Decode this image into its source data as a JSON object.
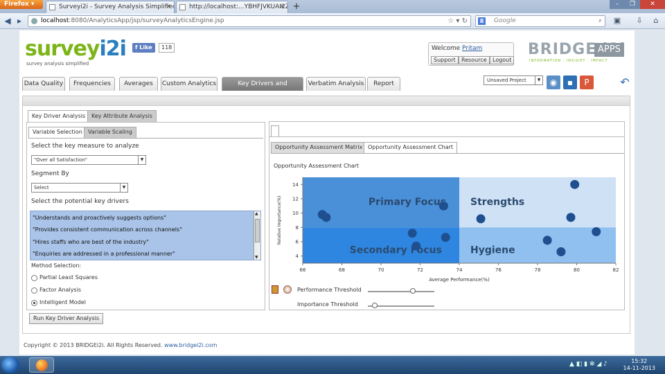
{
  "browser": {
    "menu_button": "Firefox",
    "tabs": [
      {
        "title": "Surveyi2i - Survey Analysis Simplified"
      },
      {
        "title": "http://localhost:...YBHFJVKUAI2Z6D6K"
      }
    ],
    "url_host": "localhost",
    "url_rest": ":8080/AnalyticsApp/jsp/surveyAnalyticsEngine.jsp",
    "search_engine_letter": "8",
    "search_placeholder": "Google"
  },
  "header": {
    "logo_a": "survey",
    "logo_b": "i2i",
    "tagline": "survey analysis simplified",
    "like_label": "Like",
    "like_count": "118",
    "welcome_label": "Welcome",
    "user_name": "Pritam",
    "support": "Support",
    "resource": "Resource",
    "logout": "Logout",
    "brand": "BRIDGE i2i",
    "brand_sub": "INFORMATION · INSIGHT · IMPACT",
    "apps": "APPS"
  },
  "main_tabs": [
    {
      "label": "Data Quality"
    },
    {
      "label": "Frequencies"
    },
    {
      "label": "Averages"
    },
    {
      "label": "Custom Analytics"
    },
    {
      "label": "Key Drivers and Attributes"
    },
    {
      "label": "Verbatim Analysis"
    },
    {
      "label": "Report"
    }
  ],
  "project_select": "Unsaved Project",
  "left": {
    "tabs": [
      "Key Driver Analysis",
      "Key Attribute Analysis"
    ],
    "subtabs": [
      "Variable Selection",
      "Variable Scaling"
    ],
    "measure_label": "Select the key measure to analyze",
    "measure_value": "\"Over all Satisfaction\"",
    "segment_label": "Segment By",
    "segment_value": "Select",
    "drivers_label": "Select the potential key drivers",
    "drivers": [
      "\"Understands and proactively suggests options\"",
      "\"Provides consistent communication across channels\"",
      "\"Hires staffs who are best of the industry\"",
      "\"Enquiries are addressed in a professional manner\""
    ],
    "method_label": "Method Selection:",
    "methods": [
      "Partial Least Squares",
      "Factor Analysis",
      "Intelligent Model"
    ],
    "run_button": "Run Key Driver Analysis"
  },
  "right": {
    "tabs": [
      "Opportunity Assessment Matrix",
      "Opportunity Assessment Chart"
    ],
    "chart_title": "Opportunity Assessment Chart",
    "perf_threshold_label": "Performance Threshold",
    "imp_threshold_label": "Importance Threshold",
    "perf_threshold_value": 0.68,
    "imp_threshold_value": 0.1
  },
  "chart_data": {
    "type": "scatter",
    "title": "Opportunity Assessment Chart",
    "xlabel": "Average Performance(%)",
    "ylabel": "Relative Importance(%)",
    "xlim": [
      66,
      82
    ],
    "ylim": [
      3,
      15
    ],
    "xticks": [
      66,
      68,
      70,
      72,
      74,
      76,
      78,
      80,
      82
    ],
    "yticks": [
      4,
      6,
      8,
      10,
      12,
      14
    ],
    "threshold_x": 74,
    "threshold_y": 8,
    "quadrants": [
      "Primary Focus",
      "Strengths",
      "Secondary Focus",
      "Hygiene"
    ],
    "colors": {
      "primary": "#4a90d9",
      "strengths": "#cfe1f5",
      "secondary": "#2e86e0",
      "hygiene": "#8fc0ef",
      "point": "#1f4f8f"
    },
    "points": [
      {
        "x": 67.0,
        "y": 9.8
      },
      {
        "x": 67.2,
        "y": 9.4
      },
      {
        "x": 73.2,
        "y": 11.0
      },
      {
        "x": 71.6,
        "y": 7.2
      },
      {
        "x": 71.8,
        "y": 5.4
      },
      {
        "x": 73.3,
        "y": 6.6
      },
      {
        "x": 75.1,
        "y": 9.2
      },
      {
        "x": 79.9,
        "y": 14.0
      },
      {
        "x": 79.7,
        "y": 9.4
      },
      {
        "x": 81.0,
        "y": 7.4
      },
      {
        "x": 78.5,
        "y": 6.2
      },
      {
        "x": 79.2,
        "y": 4.6
      }
    ]
  },
  "footer": {
    "text": "Copyright © 2013 BRIDGEi2i. All Rights Reserved.",
    "link": "www.bridgei2i.com"
  },
  "taskbar": {
    "time": "15:32",
    "date": "14-11-2013"
  }
}
